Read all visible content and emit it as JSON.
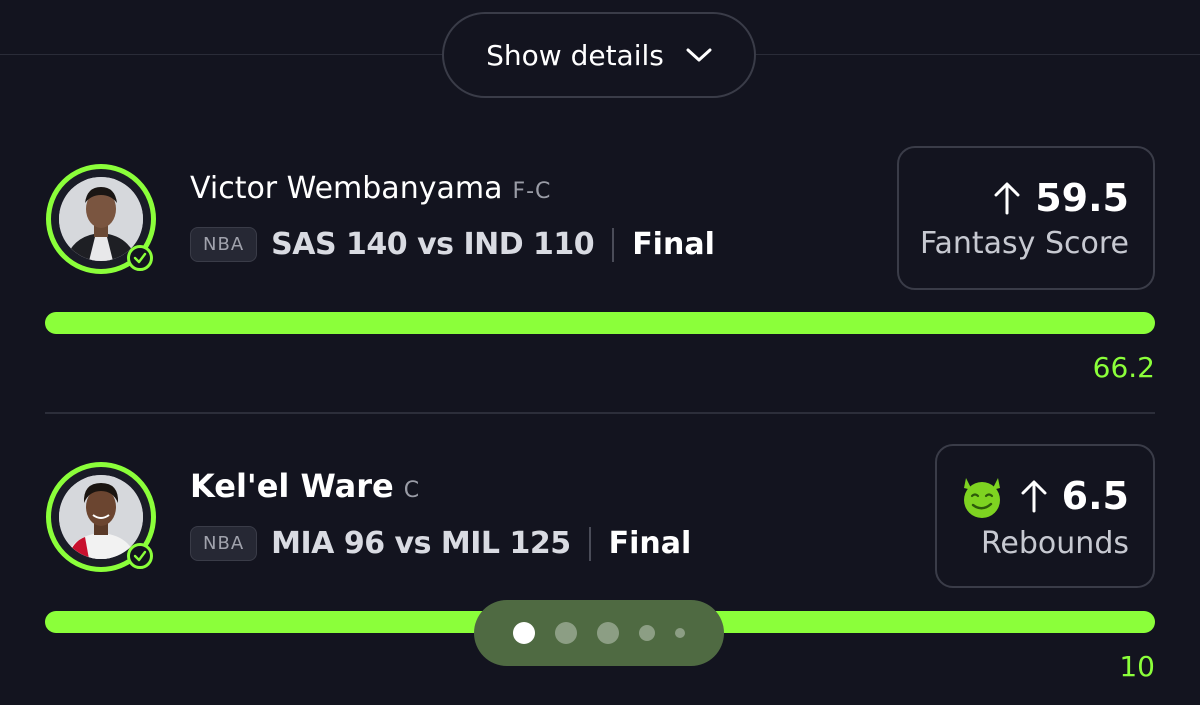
{
  "header": {
    "show_details_label": "Show details"
  },
  "picks": [
    {
      "player": "Victor Wembanyama",
      "position": "F-C",
      "league": "NBA",
      "matchup": "SAS 140 vs IND 110",
      "status": "Final",
      "line": "59.5",
      "stat_type": "Fantasy Score",
      "direction": "over",
      "result": "66.2",
      "progress": 1.0,
      "has_emoji": false
    },
    {
      "player": "Kel'el Ware",
      "position": "C",
      "league": "NBA",
      "matchup": "MIA 96 vs MIL 125",
      "status": "Final",
      "line": "6.5",
      "stat_type": "Rebounds",
      "direction": "over",
      "result": "10",
      "progress": 1.0,
      "has_emoji": true
    }
  ],
  "pager": {
    "pages": 5,
    "current": 1
  },
  "colors": {
    "accent": "#8bff3a",
    "background": "#13141f",
    "pager_bg": "#4f6a42"
  }
}
